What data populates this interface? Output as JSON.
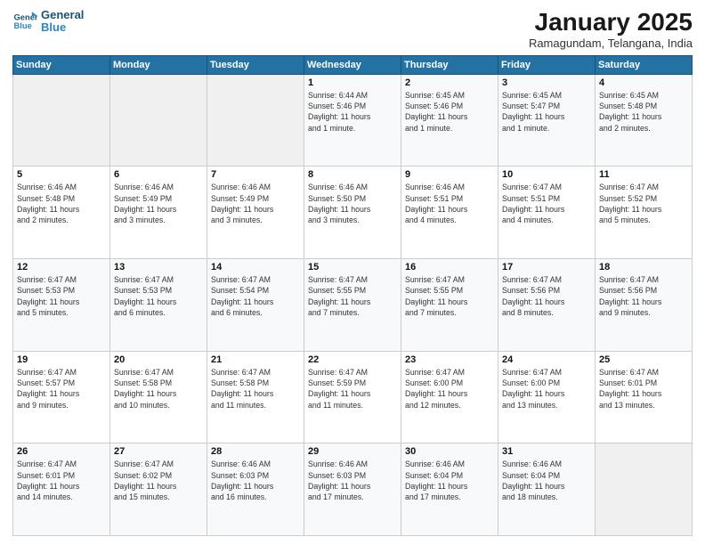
{
  "logo": {
    "line1": "General",
    "line2": "Blue"
  },
  "header": {
    "month": "January 2025",
    "location": "Ramagundam, Telangana, India"
  },
  "weekdays": [
    "Sunday",
    "Monday",
    "Tuesday",
    "Wednesday",
    "Thursday",
    "Friday",
    "Saturday"
  ],
  "weeks": [
    [
      {
        "day": "",
        "info": ""
      },
      {
        "day": "",
        "info": ""
      },
      {
        "day": "",
        "info": ""
      },
      {
        "day": "1",
        "info": "Sunrise: 6:44 AM\nSunset: 5:46 PM\nDaylight: 11 hours\nand 1 minute."
      },
      {
        "day": "2",
        "info": "Sunrise: 6:45 AM\nSunset: 5:46 PM\nDaylight: 11 hours\nand 1 minute."
      },
      {
        "day": "3",
        "info": "Sunrise: 6:45 AM\nSunset: 5:47 PM\nDaylight: 11 hours\nand 1 minute."
      },
      {
        "day": "4",
        "info": "Sunrise: 6:45 AM\nSunset: 5:48 PM\nDaylight: 11 hours\nand 2 minutes."
      }
    ],
    [
      {
        "day": "5",
        "info": "Sunrise: 6:46 AM\nSunset: 5:48 PM\nDaylight: 11 hours\nand 2 minutes."
      },
      {
        "day": "6",
        "info": "Sunrise: 6:46 AM\nSunset: 5:49 PM\nDaylight: 11 hours\nand 3 minutes."
      },
      {
        "day": "7",
        "info": "Sunrise: 6:46 AM\nSunset: 5:49 PM\nDaylight: 11 hours\nand 3 minutes."
      },
      {
        "day": "8",
        "info": "Sunrise: 6:46 AM\nSunset: 5:50 PM\nDaylight: 11 hours\nand 3 minutes."
      },
      {
        "day": "9",
        "info": "Sunrise: 6:46 AM\nSunset: 5:51 PM\nDaylight: 11 hours\nand 4 minutes."
      },
      {
        "day": "10",
        "info": "Sunrise: 6:47 AM\nSunset: 5:51 PM\nDaylight: 11 hours\nand 4 minutes."
      },
      {
        "day": "11",
        "info": "Sunrise: 6:47 AM\nSunset: 5:52 PM\nDaylight: 11 hours\nand 5 minutes."
      }
    ],
    [
      {
        "day": "12",
        "info": "Sunrise: 6:47 AM\nSunset: 5:53 PM\nDaylight: 11 hours\nand 5 minutes."
      },
      {
        "day": "13",
        "info": "Sunrise: 6:47 AM\nSunset: 5:53 PM\nDaylight: 11 hours\nand 6 minutes."
      },
      {
        "day": "14",
        "info": "Sunrise: 6:47 AM\nSunset: 5:54 PM\nDaylight: 11 hours\nand 6 minutes."
      },
      {
        "day": "15",
        "info": "Sunrise: 6:47 AM\nSunset: 5:55 PM\nDaylight: 11 hours\nand 7 minutes."
      },
      {
        "day": "16",
        "info": "Sunrise: 6:47 AM\nSunset: 5:55 PM\nDaylight: 11 hours\nand 7 minutes."
      },
      {
        "day": "17",
        "info": "Sunrise: 6:47 AM\nSunset: 5:56 PM\nDaylight: 11 hours\nand 8 minutes."
      },
      {
        "day": "18",
        "info": "Sunrise: 6:47 AM\nSunset: 5:56 PM\nDaylight: 11 hours\nand 9 minutes."
      }
    ],
    [
      {
        "day": "19",
        "info": "Sunrise: 6:47 AM\nSunset: 5:57 PM\nDaylight: 11 hours\nand 9 minutes."
      },
      {
        "day": "20",
        "info": "Sunrise: 6:47 AM\nSunset: 5:58 PM\nDaylight: 11 hours\nand 10 minutes."
      },
      {
        "day": "21",
        "info": "Sunrise: 6:47 AM\nSunset: 5:58 PM\nDaylight: 11 hours\nand 11 minutes."
      },
      {
        "day": "22",
        "info": "Sunrise: 6:47 AM\nSunset: 5:59 PM\nDaylight: 11 hours\nand 11 minutes."
      },
      {
        "day": "23",
        "info": "Sunrise: 6:47 AM\nSunset: 6:00 PM\nDaylight: 11 hours\nand 12 minutes."
      },
      {
        "day": "24",
        "info": "Sunrise: 6:47 AM\nSunset: 6:00 PM\nDaylight: 11 hours\nand 13 minutes."
      },
      {
        "day": "25",
        "info": "Sunrise: 6:47 AM\nSunset: 6:01 PM\nDaylight: 11 hours\nand 13 minutes."
      }
    ],
    [
      {
        "day": "26",
        "info": "Sunrise: 6:47 AM\nSunset: 6:01 PM\nDaylight: 11 hours\nand 14 minutes."
      },
      {
        "day": "27",
        "info": "Sunrise: 6:47 AM\nSunset: 6:02 PM\nDaylight: 11 hours\nand 15 minutes."
      },
      {
        "day": "28",
        "info": "Sunrise: 6:46 AM\nSunset: 6:03 PM\nDaylight: 11 hours\nand 16 minutes."
      },
      {
        "day": "29",
        "info": "Sunrise: 6:46 AM\nSunset: 6:03 PM\nDaylight: 11 hours\nand 17 minutes."
      },
      {
        "day": "30",
        "info": "Sunrise: 6:46 AM\nSunset: 6:04 PM\nDaylight: 11 hours\nand 17 minutes."
      },
      {
        "day": "31",
        "info": "Sunrise: 6:46 AM\nSunset: 6:04 PM\nDaylight: 11 hours\nand 18 minutes."
      },
      {
        "day": "",
        "info": ""
      }
    ]
  ],
  "colors": {
    "header_bg": "#2471a3",
    "header_text": "#ffffff",
    "accent": "#1a5276"
  }
}
